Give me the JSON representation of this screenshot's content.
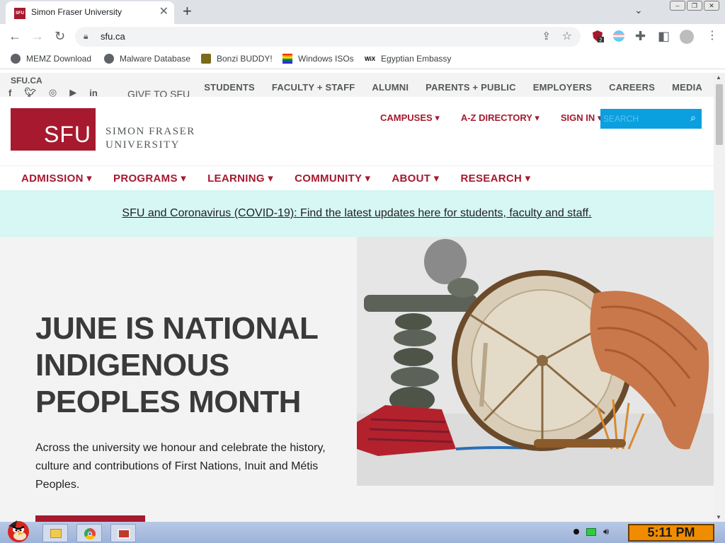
{
  "browser": {
    "tab_title": "Simon Fraser University",
    "tab_favicon_text": "SFU",
    "url": "sfu.ca",
    "extension_badge": "2"
  },
  "bookmarks": [
    {
      "label": "MEMZ Download"
    },
    {
      "label": "Malware Database"
    },
    {
      "label": "Bonzi BUDDY!"
    },
    {
      "label": "Windows ISOs"
    },
    {
      "label": "Egyptian Embassy"
    }
  ],
  "site": {
    "domain_label": "SFU.CA",
    "give_label": "GIVE TO SFU",
    "audience_nav": [
      "STUDENTS",
      "FACULTY + STAFF",
      "ALUMNI",
      "PARENTS + PUBLIC",
      "EMPLOYERS",
      "CAREERS",
      "MEDIA"
    ],
    "logo_abbr": "SFU",
    "logo_line1": "SIMON FRASER",
    "logo_line2": "UNIVERSITY",
    "utility_nav": [
      "CAMPUSES",
      "A-Z DIRECTORY",
      "SIGN IN"
    ],
    "search_placeholder": "SEARCH",
    "main_nav": [
      "ADMISSION",
      "PROGRAMS",
      "LEARNING",
      "COMMUNITY",
      "ABOUT",
      "RESEARCH"
    ],
    "alert_text": "SFU and Coronavirus (COVID-19): Find the latest updates here for students, faculty and staff.",
    "hero_title": "JUNE IS NATIONAL INDIGENOUS PEOPLES MONTH",
    "hero_body": "Across the university we honour and celebrate the history, culture and contributions of First Nations, Inuit and Métis Peoples."
  },
  "taskbar": {
    "clock": "5:11 PM"
  },
  "colors": {
    "sfu_red": "#a6192e",
    "search_blue": "#0aa0e0",
    "alert_bg": "#d6f7f3"
  }
}
